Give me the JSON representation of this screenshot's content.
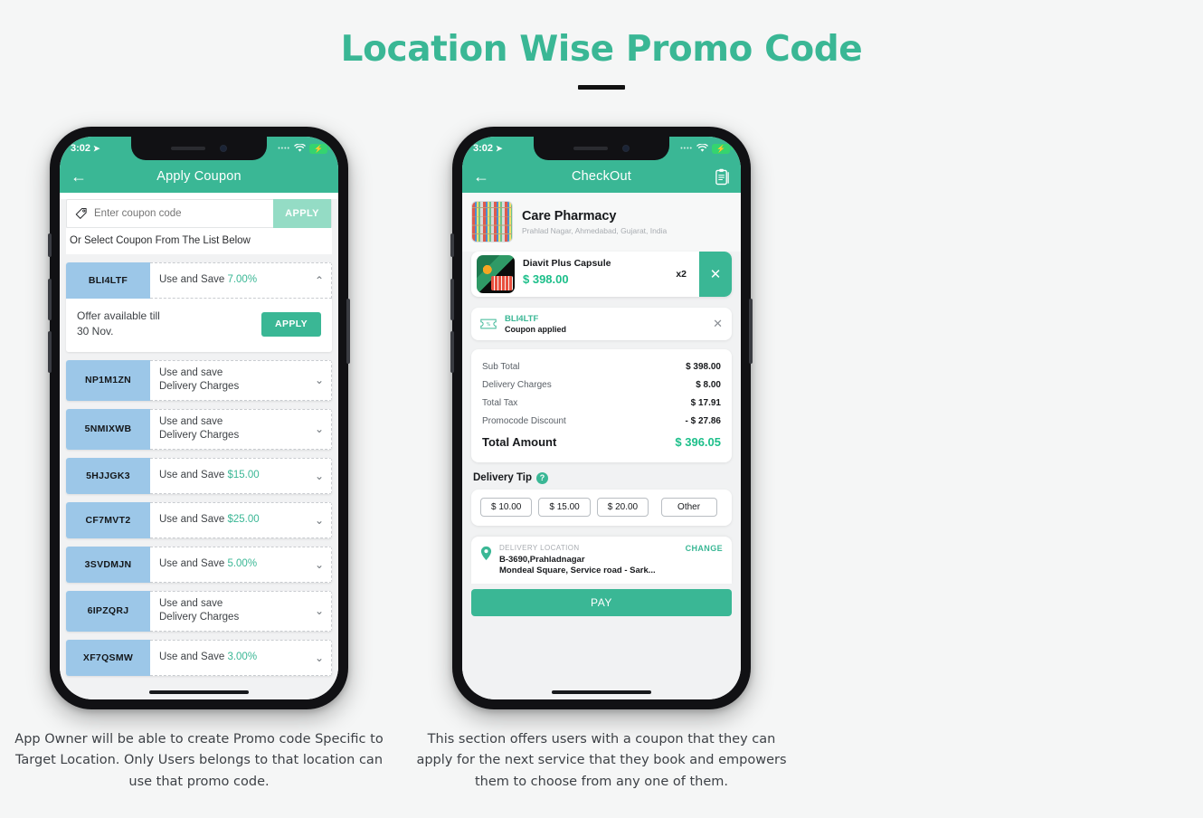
{
  "header": {
    "title": "Location Wise Promo Code"
  },
  "colors": {
    "accent": "#3ab795",
    "accent_light": "#94dcc5",
    "coupon_tab": "#9cc7e8",
    "price_green": "#1dbf8a",
    "page_bg": "#f5f6f6"
  },
  "phone_left": {
    "statusbar": {
      "time": "3:02",
      "location_icon": "➤",
      "signal_dots": "••••",
      "wifi_icon": "wifi-icon",
      "battery_icon": "⚡"
    },
    "appbar": {
      "back_icon": "←",
      "title": "Apply Coupon"
    },
    "coupon_input": {
      "icon": "tag-icon",
      "placeholder": "Enter coupon code",
      "value": "",
      "apply_label": "APPLY"
    },
    "list_hint": "Or Select Coupon From The List Below",
    "coupons": [
      {
        "code": "BLI4LTF",
        "desc_prefix": "Use and Save ",
        "desc_value": "7.00%",
        "desc_line2": "",
        "chevron": "⌃",
        "expanded": true,
        "offer_line1": "Offer available till",
        "offer_line2": "30 Nov.",
        "apply_label": "APPLY"
      },
      {
        "code": "NP1M1ZN",
        "desc_prefix": "Use and save",
        "desc_value": "",
        "desc_line2": "Delivery Charges",
        "chevron": "⌄",
        "expanded": false
      },
      {
        "code": "5NMIXWB",
        "desc_prefix": "Use and save",
        "desc_value": "",
        "desc_line2": "Delivery Charges",
        "chevron": "⌄",
        "expanded": false
      },
      {
        "code": "5HJJGK3",
        "desc_prefix": "Use and Save ",
        "desc_value": "$15.00",
        "desc_line2": "",
        "chevron": "⌄",
        "expanded": false
      },
      {
        "code": "CF7MVT2",
        "desc_prefix": "Use and Save ",
        "desc_value": "$25.00",
        "desc_line2": "",
        "chevron": "⌄",
        "expanded": false
      },
      {
        "code": "3SVDMJN",
        "desc_prefix": "Use and Save ",
        "desc_value": "5.00%",
        "desc_line2": "",
        "chevron": "⌄",
        "expanded": false
      },
      {
        "code": "6IPZQRJ",
        "desc_prefix": "Use and save",
        "desc_value": "",
        "desc_line2": "Delivery Charges",
        "chevron": "⌄",
        "expanded": false
      },
      {
        "code": "XF7QSMW",
        "desc_prefix": "Use and Save ",
        "desc_value": "3.00%",
        "desc_line2": "",
        "chevron": "⌄",
        "expanded": false
      }
    ]
  },
  "phone_right": {
    "statusbar": {
      "time": "3:02",
      "location_icon": "➤",
      "signal_dots": "••••",
      "wifi_icon": "wifi-icon",
      "battery_icon": "⚡"
    },
    "appbar": {
      "back_icon": "←",
      "title": "CheckOut",
      "trailing_icon": "clipboard-icon"
    },
    "store": {
      "name": "Care Pharmacy",
      "address": "Prahlad Nagar, Ahmedabad, Gujarat, India",
      "thumb": "pharmacy-shelf-image"
    },
    "cart_item": {
      "name": "Diavit Plus Capsule",
      "price": "$ 398.00",
      "qty": "x2",
      "remove_icon": "✕"
    },
    "coupon_applied": {
      "icon": "coupon-icon",
      "code": "BLI4LTF",
      "label": "Coupon applied",
      "remove_icon": "✕"
    },
    "bill": {
      "rows": [
        {
          "label": "Sub Total",
          "value": "$ 398.00"
        },
        {
          "label": "Delivery Charges",
          "value": "$ 8.00"
        },
        {
          "label": "Total Tax",
          "value": "$ 17.91"
        },
        {
          "label": "Promocode Discount",
          "value": "- $ 27.86"
        }
      ],
      "total_label": "Total Amount",
      "total_value": "$ 396.05"
    },
    "delivery_tip": {
      "title": "Delivery Tip",
      "help_icon": "?",
      "options": [
        "$ 10.00",
        "$ 15.00",
        "$ 20.00",
        "Other"
      ]
    },
    "delivery_location": {
      "pin_icon": "location-pin-icon",
      "label": "DELIVERY LOCATION",
      "change_label": "CHANGE",
      "line1": "B-3690,Prahladnagar",
      "line2": "Mondeal Square, Service road - Sark..."
    },
    "pay_label": "PAY"
  },
  "captions": {
    "left": "App Owner will be able to create Promo code Specific to Target Location. Only Users belongs to that location can use that promo code.",
    "right": "This section offers users with a coupon that they can apply for the next service that they book and empowers them to choose from any one of them."
  }
}
